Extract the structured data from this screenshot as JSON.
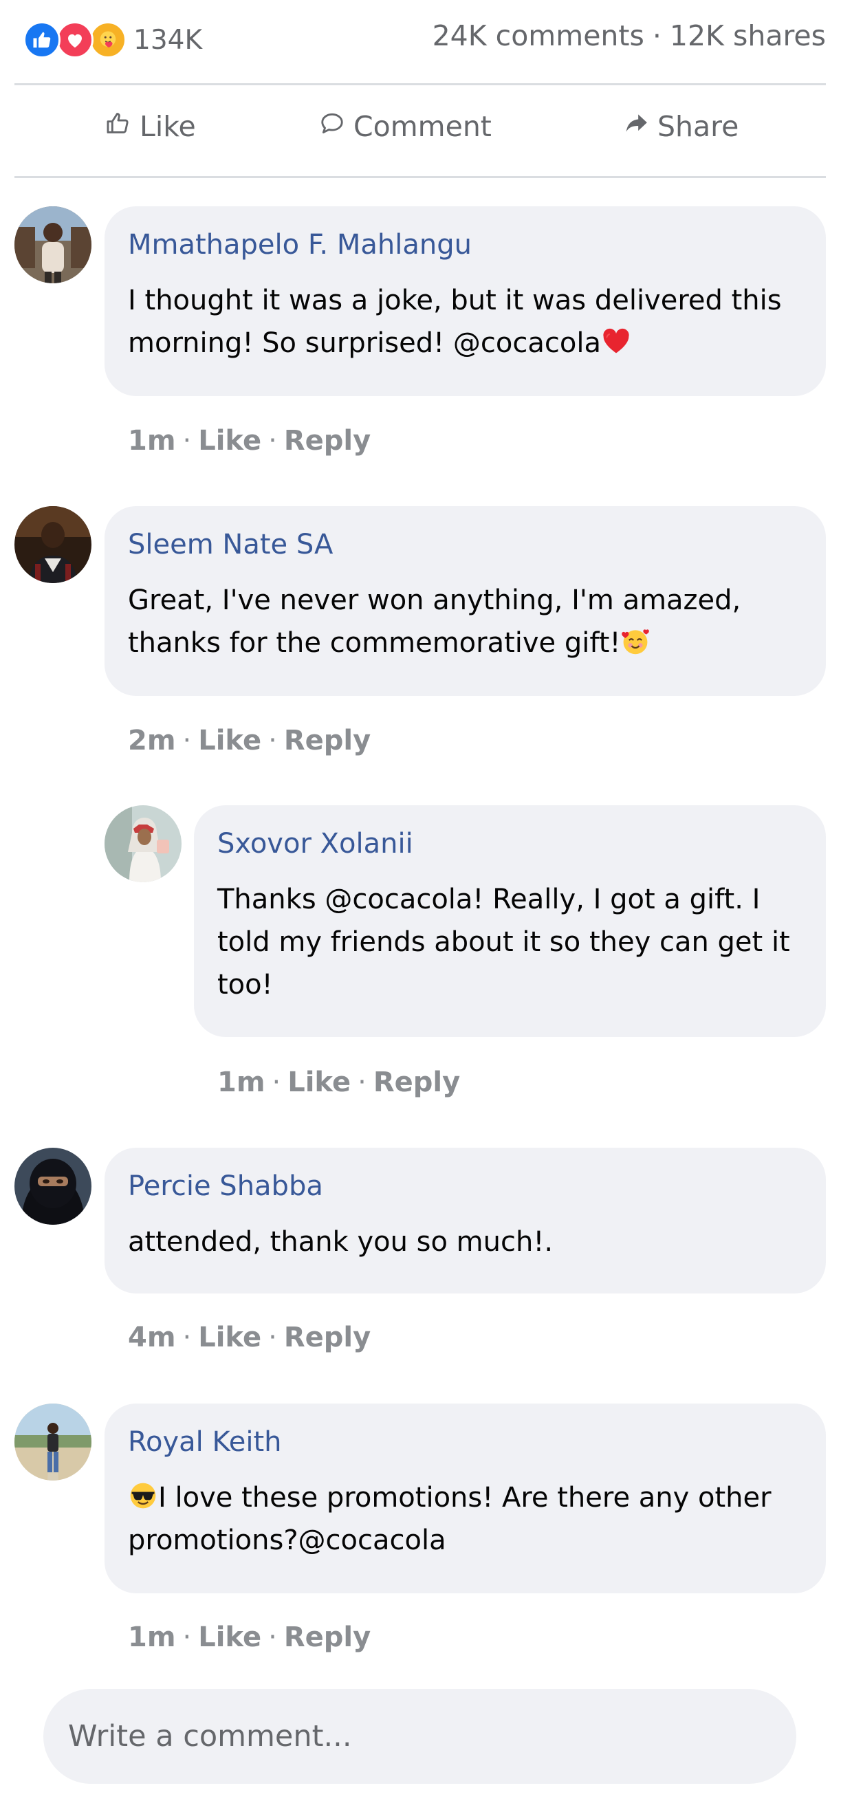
{
  "post_stats": {
    "reaction_icons": [
      "like-icon",
      "love-icon",
      "care-icon"
    ],
    "reaction_count": "134K",
    "comments": "24K comments",
    "separator": "·",
    "shares": "12K shares"
  },
  "actions": {
    "like": "Like",
    "comment": "Comment",
    "share": "Share"
  },
  "comments": [
    {
      "author": "Mmathapelo F. Mahlangu",
      "text": "I thought it was a joke, but it was delivered this morning! So surprised! @cocacola",
      "emoji": "red-heart",
      "time": "1m",
      "like": "Like",
      "reply": "Reply"
    },
    {
      "author": "Sleem Nate SA",
      "text": "Great, I've never won anything, I'm amazed, thanks for the commemorative gift!",
      "emoji": "smiling-face-with-hearts",
      "time": "2m",
      "like": "Like",
      "reply": "Reply"
    },
    {
      "author": "Sxovor Xolanii",
      "text": "Thanks @cocacola! Really, I got a gift. I told my friends about it so they can get it too!",
      "time": "1m",
      "like": "Like",
      "reply": "Reply"
    },
    {
      "author": "Percie Shabba",
      "text": "attended, thank you so much!.",
      "time": "4m",
      "like": "Like",
      "reply": "Reply"
    },
    {
      "author": "Royal Keith",
      "text": "I love these promotions! Are there any other promotions?@cocacola",
      "emoji": "smiling-face-with-sunglasses",
      "time": "1m",
      "like": "Like",
      "reply": "Reply"
    }
  ],
  "composer": {
    "placeholder": "Write a comment..."
  },
  "colors": {
    "author_name": "#385898",
    "bubble_bg": "#f0f1f5",
    "meta_text": "#8a8d91",
    "like_blue": "#1877f2",
    "love_red": "#f33e58"
  }
}
